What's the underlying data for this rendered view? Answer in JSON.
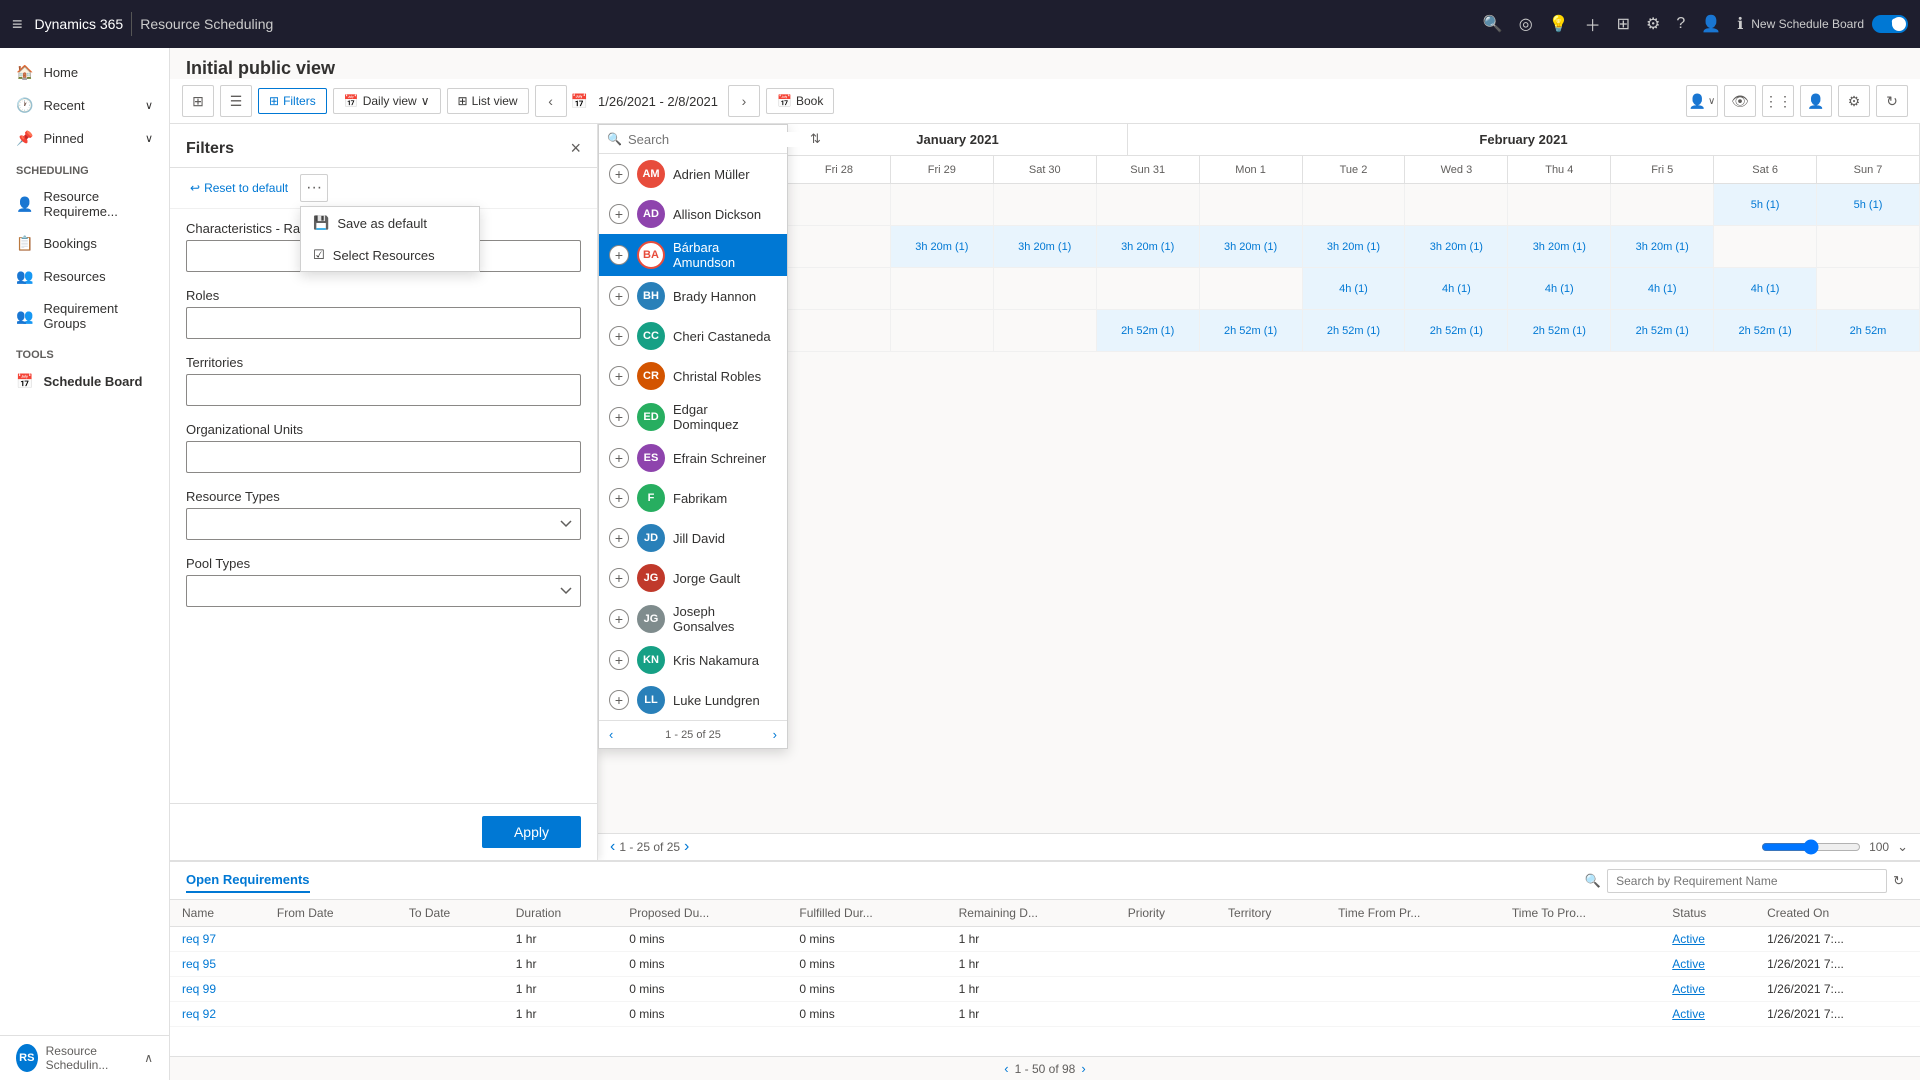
{
  "app": {
    "brand": "Dynamics 365",
    "module": "Resource Scheduling"
  },
  "topnav": {
    "new_schedule_board": "New Schedule Board",
    "toggle_state": "On"
  },
  "sidebar": {
    "home": "Home",
    "recent": "Recent",
    "pinned": "Pinned",
    "scheduling_section": "Scheduling",
    "resource_requirements": "Resource Requireme...",
    "bookings": "Bookings",
    "resources": "Resources",
    "requirement_groups": "Requirement Groups",
    "tools_section": "Tools",
    "schedule_board": "Schedule Board",
    "bottom_label": "Resource Schedulin...",
    "bottom_initials": "RS"
  },
  "page": {
    "title": "Initial public view"
  },
  "toolbar": {
    "filters_label": "Filters",
    "daily_view_label": "Daily view",
    "list_view_label": "List view",
    "book_label": "Book",
    "date_range": "1/26/2021 - 2/8/2021"
  },
  "filters": {
    "title": "Filters",
    "reset_label": "Reset to default",
    "save_default": "Save as default",
    "select_resources": "Select Resources",
    "characteristics_label": "Characteristics - Ratin",
    "roles_label": "Roles",
    "territories_label": "Territories",
    "organizational_units_label": "Organizational Units",
    "resource_types_label": "Resource Types",
    "pool_types_label": "Pool Types",
    "apply_label": "Apply"
  },
  "resource_search": {
    "placeholder": "Search",
    "resources": [
      {
        "name": "Adrien Müller",
        "initials": "AM",
        "color": "#e74c3c"
      },
      {
        "name": "Allison Dickson",
        "initials": "AD",
        "color": "#8e44ad"
      },
      {
        "name": "Bárbara Amundson",
        "initials": "BA",
        "color": "#e74c3c",
        "selected": true
      },
      {
        "name": "Brady Hannon",
        "initials": "BH",
        "color": "#2980b9"
      },
      {
        "name": "Cheri Castaneda",
        "initials": "CC",
        "color": "#16a085"
      },
      {
        "name": "Christal Robles",
        "initials": "CR",
        "color": "#d35400"
      },
      {
        "name": "Edgar Dominquez",
        "initials": "ED",
        "color": "#27ae60"
      },
      {
        "name": "Efrain Schreiner",
        "initials": "ES",
        "color": "#8e44ad"
      },
      {
        "name": "Fabrikam",
        "initials": "F",
        "color": "#27ae60"
      },
      {
        "name": "Jill David",
        "initials": "JD",
        "color": "#2980b9"
      },
      {
        "name": "Jorge Gault",
        "initials": "JG",
        "color": "#c0392b"
      },
      {
        "name": "Joseph Gonsalves",
        "initials": "JG",
        "color": "#7f8c8d"
      },
      {
        "name": "Kris Nakamura",
        "initials": "KN",
        "color": "#16a085"
      },
      {
        "name": "Luke Lundgren",
        "initials": "LL",
        "color": "#2980b9"
      }
    ],
    "pagination": "1 - 25 of 25"
  },
  "grid": {
    "months": [
      {
        "name": "January 2021",
        "span": 4
      },
      {
        "name": "February 2021",
        "span": 7
      }
    ],
    "days": [
      "Fri 29",
      "Sat 30",
      "Sun 31",
      "Mon 1",
      "Tue 2",
      "Wed 3",
      "Thu 4",
      "Fri 5",
      "Sat 6",
      "Sun 7"
    ],
    "rows": [
      {
        "cells": [
          "",
          "",
          "",
          "",
          "",
          "",
          "",
          "",
          "5h (1)",
          "5h (1)"
        ]
      },
      {
        "cells": [
          "3h 20m (1)",
          "3h 20m (1)",
          "3h 20m (1)",
          "3h 20m (1)",
          "3h 20m (1)",
          "3h 20m (1)",
          "3h 20m (1)",
          "3h 20m (1)",
          "",
          ""
        ]
      },
      {
        "cells": [
          "",
          "",
          "",
          "",
          "4h (1)",
          "4h (1)",
          "4h (1)",
          "4h (1)",
          "4h (1)",
          ""
        ]
      },
      {
        "cells": [
          "",
          "",
          "2h 52m (1)",
          "2h 52m (1)",
          "2h 52m (1)",
          "2h 52m (1)",
          "2h 52m (1)",
          "2h 52m (1)",
          "2h 52m (1)",
          "2h 52m"
        ]
      }
    ]
  },
  "requirements": {
    "tab_label": "Open Requirements",
    "search_placeholder": "Search by Requirement Name",
    "columns": [
      "Name",
      "From Date",
      "To Date",
      "Duration",
      "Proposed Du...",
      "Fulfilled Dur...",
      "Remaining D...",
      "Priority",
      "Territory",
      "Time From Pr...",
      "Time To Pro...",
      "Status",
      "Created On"
    ],
    "rows": [
      {
        "name": "req 97",
        "from_date": "",
        "to_date": "",
        "duration": "1 hr",
        "proposed": "0 mins",
        "fulfilled": "0 mins",
        "remaining": "1 hr",
        "priority": "",
        "territory": "",
        "time_from": "",
        "time_to": "",
        "status": "Active",
        "created": "1/26/2021 7:..."
      },
      {
        "name": "req 95",
        "from_date": "",
        "to_date": "",
        "duration": "1 hr",
        "proposed": "0 mins",
        "fulfilled": "0 mins",
        "remaining": "1 hr",
        "priority": "",
        "territory": "",
        "time_from": "",
        "time_to": "",
        "status": "Active",
        "created": "1/26/2021 7:..."
      },
      {
        "name": "req 99",
        "from_date": "",
        "to_date": "",
        "duration": "1 hr",
        "proposed": "0 mins",
        "fulfilled": "0 mins",
        "remaining": "1 hr",
        "priority": "",
        "territory": "",
        "time_from": "",
        "time_to": "",
        "status": "Active",
        "created": "1/26/2021 7:..."
      },
      {
        "name": "req 92",
        "from_date": "",
        "to_date": "",
        "duration": "1 hr",
        "proposed": "0 mins",
        "fulfilled": "0 mins",
        "remaining": "1 hr",
        "priority": "",
        "territory": "",
        "time_from": "",
        "time_to": "",
        "status": "Active",
        "created": "1/26/2021 7:..."
      }
    ],
    "pagination": {
      "current": "1 - 50 of 98",
      "has_prev": false,
      "has_next": true
    }
  },
  "zoom": {
    "value": 100
  },
  "icons": {
    "hamburger": "≡",
    "search": "🔍",
    "target": "◎",
    "question_mark": "?",
    "bell": "🔔",
    "plus": "+",
    "filter": "⊞",
    "settings": "⚙",
    "person": "👤",
    "close": "×",
    "reset": "↩",
    "more": "···",
    "sort": "⇅",
    "chevron_left": "‹",
    "chevron_right": "›",
    "chevron_down": "∨",
    "calendar": "📅",
    "grid_view": "⊞",
    "list_view": "☰",
    "eye": "👁",
    "columns": "⋮⋮⋮",
    "person_add": "👤+",
    "refresh": "↻",
    "expand": "⌄",
    "add_circle": "⊕",
    "save_icon": "💾",
    "select_icon": "☑"
  }
}
